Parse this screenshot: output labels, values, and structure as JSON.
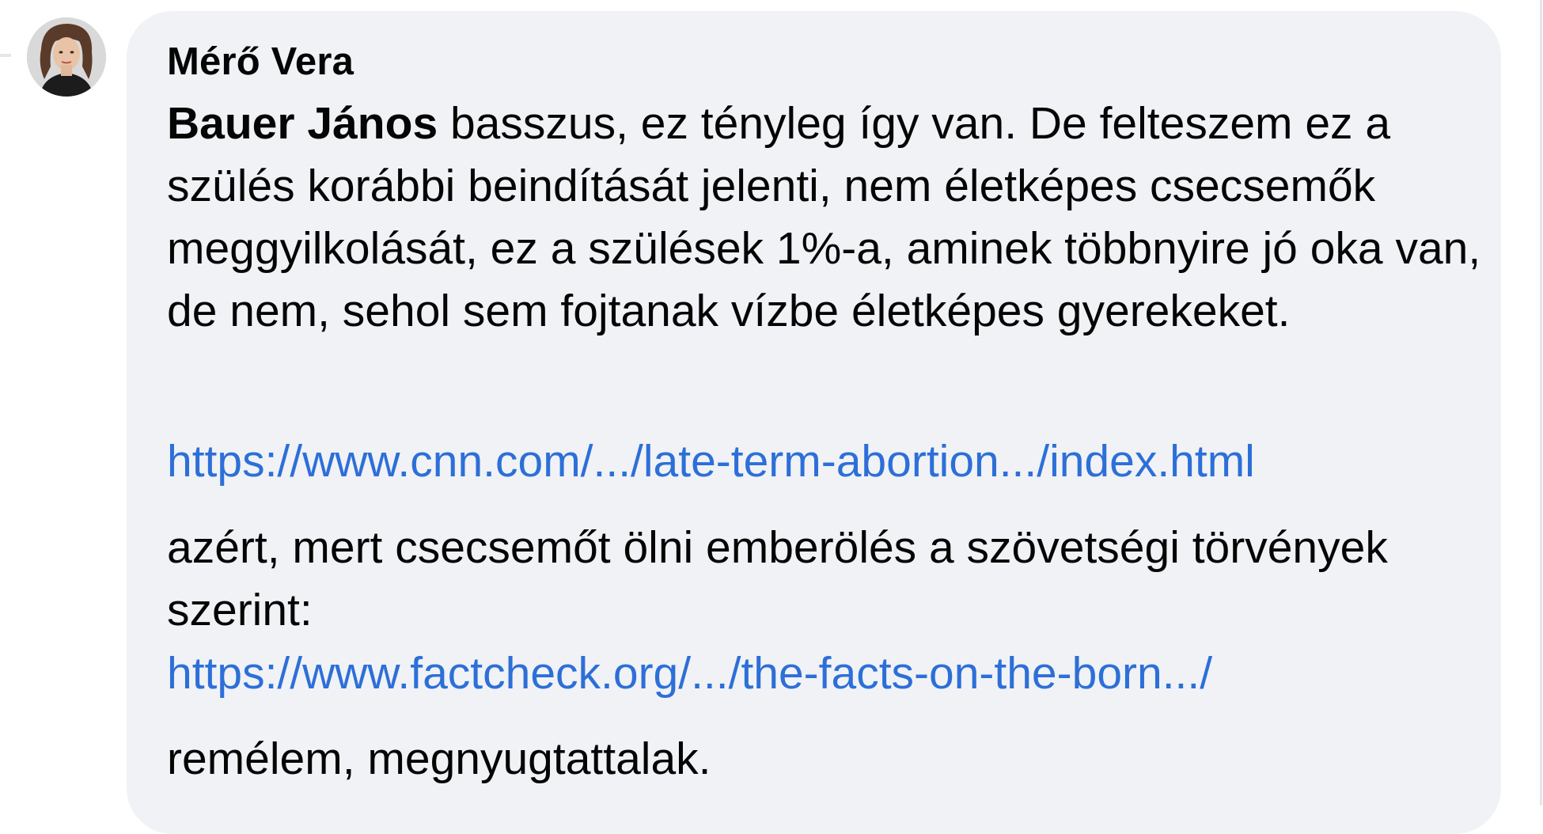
{
  "comment": {
    "author": "Mérő Vera",
    "mention": "Bauer János",
    "paragraph1_rest": " basszus, ez tényleg így van. De felteszem ez a szülés korábbi beindítását jelenti, nem életképes csecsemők meggyilkolását, ez a szülések 1%-a, aminek többnyire jó oka van, de nem, sehol sem fojtanak vízbe életképes gyerekeket.",
    "link1": "https://www.cnn.com/.../late-term-abortion.../index.html",
    "paragraph2": "azért, mert csecsemőt ölni emberölés a szövetségi törvények szerint:",
    "link2": "https://www.factcheck.org/.../the-facts-on-the-born.../",
    "paragraph3": "remélem, megnyugtattalak."
  },
  "colors": {
    "bubble": "#f0f2f5",
    "text": "#050505",
    "link": "#2d6fd8"
  },
  "icons": {
    "avatar": "profile-photo"
  }
}
